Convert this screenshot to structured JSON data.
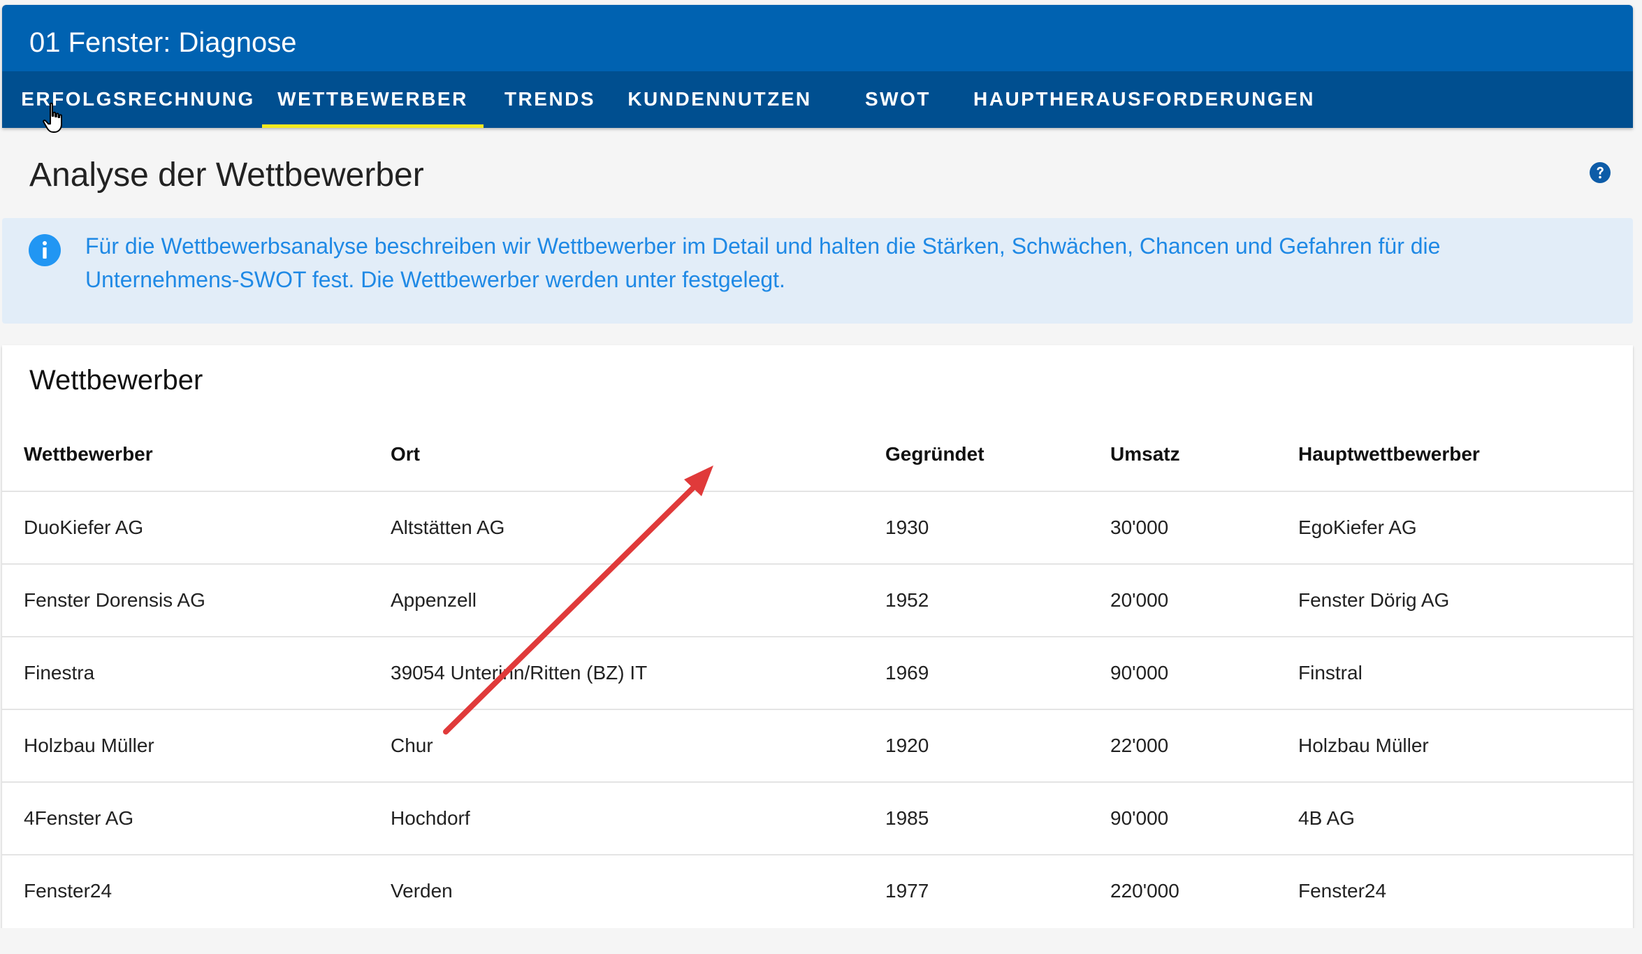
{
  "app": {
    "title": "01 Fenster: Diagnose"
  },
  "tabs": [
    {
      "label": "ERFOLGSRECHNUNG",
      "active": false
    },
    {
      "label": "WETTBEWERBER",
      "active": true
    },
    {
      "label": "TRENDS",
      "active": false
    },
    {
      "label": "KUNDENNUTZEN",
      "active": false
    },
    {
      "label": "SWOT",
      "active": false
    },
    {
      "label": "HAUPTHERAUSFORDERUNGEN",
      "active": false
    }
  ],
  "page": {
    "title": "Analyse der Wettbewerber",
    "help_icon": "help-icon"
  },
  "info": {
    "icon": "info-icon",
    "text": "Für die Wettbewerbsanalyse beschreiben wir Wettbewerber im Detail und halten die Stärken, Schwächen, Chancen und Gefahren für die Unternehmens-SWOT fest. Die Wettbewerber werden unter festgelegt."
  },
  "competitors": {
    "title": "Wettbewerber",
    "columns": [
      "Wettbewerber",
      "Ort",
      "Gegründet",
      "Umsatz",
      "Hauptwettbewerber"
    ],
    "rows": [
      [
        "DuoKiefer AG",
        "Altstätten AG",
        "1930",
        "30'000",
        "EgoKiefer AG"
      ],
      [
        "Fenster Dorensis AG",
        "Appenzell",
        "1952",
        "20'000",
        "Fenster Dörig AG"
      ],
      [
        "Finestra",
        "39054 Unterinn/Ritten (BZ) IT",
        "1969",
        "90'000",
        "Finstral"
      ],
      [
        "Holzbau Müller",
        "Chur",
        "1920",
        "22'000",
        "Holzbau Müller"
      ],
      [
        "4Fenster AG",
        "Hochdorf",
        "1985",
        "90'000",
        "4B AG"
      ],
      [
        "Fenster24",
        "Verden",
        "1977",
        "220'000",
        "Fenster24"
      ]
    ]
  },
  "colors": {
    "app_bar": "#0062b1",
    "tab_bar": "#004f90",
    "active_tab_indicator": "#f5e91e",
    "info_background": "#e2edf8",
    "info_text": "#1f89e5",
    "annotation_arrow": "#e03a3a"
  }
}
